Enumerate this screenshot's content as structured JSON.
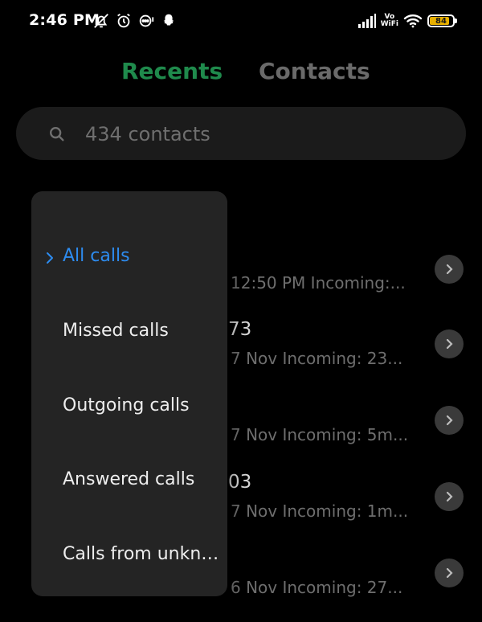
{
  "status_bar": {
    "time": "2:46 PM",
    "volte_top": "Vo",
    "volte_bottom": "WiFi",
    "battery_level": "84",
    "battery_fraction": 0.84
  },
  "tabs": {
    "recents": "Recents",
    "contacts": "Contacts"
  },
  "search": {
    "placeholder": "434 contacts"
  },
  "calls": [
    {
      "name": "",
      "detail": "12:50 PM Incoming:..."
    },
    {
      "name": "73",
      "detail": "7 Nov Incoming: 23..."
    },
    {
      "name": "",
      "detail": "7 Nov Incoming: 5m..."
    },
    {
      "name": "03",
      "detail": "7 Nov Incoming: 1m..."
    },
    {
      "name": "",
      "detail": "6 Nov Incoming: 27..."
    }
  ],
  "menu": {
    "items": [
      {
        "label": "All calls",
        "selected": true
      },
      {
        "label": "Missed calls",
        "selected": false
      },
      {
        "label": "Outgoing calls",
        "selected": false
      },
      {
        "label": "Answered calls",
        "selected": false
      },
      {
        "label": "Calls from unknown numbers",
        "selected": false
      }
    ]
  },
  "colors": {
    "background": "#000000",
    "tab_active": "#1f8a4c",
    "tab_inactive": "#6a6a6a",
    "menu_background": "#242424",
    "menu_selected": "#2d8cf0",
    "battery_fill": "#e8b000"
  },
  "icons": {
    "status": [
      "muted-bell-icon",
      "alarm-icon",
      "chat-bubble-icon",
      "snapchat-ghost-icon"
    ],
    "status_right": [
      "signal-icon",
      "wifi-icon",
      "battery-icon"
    ],
    "search": "search-icon",
    "row_action": "chevron-right-icon",
    "menu_selected": "chevron-right-icon"
  }
}
